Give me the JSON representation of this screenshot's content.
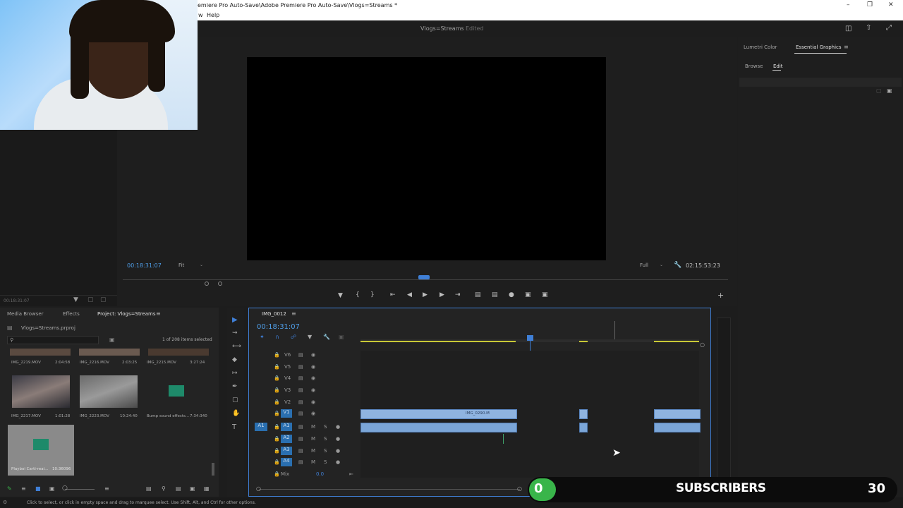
{
  "window": {
    "title": "emiere Pro Auto-Save\\Adobe Premiere Pro Auto-Save\\Vlogs=Streams *",
    "menu": [
      "w",
      "Help"
    ]
  },
  "header": {
    "sequence_title": "Vlogs=Streams",
    "status": "Edited"
  },
  "source_panel": {
    "timecode": "00:18:31:07"
  },
  "program_monitor": {
    "timecode_left": "00:18:31:07",
    "fit": "Fit",
    "quality": "Full",
    "timecode_right": "02:15:53:23"
  },
  "right_panel": {
    "tabs": [
      "Lumetri Color",
      "Essential Graphics"
    ],
    "subtabs": [
      "Browse",
      "Edit"
    ]
  },
  "project_panel": {
    "tabs": [
      "Media Browser",
      "Effects",
      "Project: Vlogs=Streams"
    ],
    "file": "Vlogs=Streams.prproj",
    "selection": "1 of 208 items selected",
    "items": [
      {
        "name": "IMG_2219.MOV",
        "duration": "2:04:58"
      },
      {
        "name": "IMG_2216.MOV",
        "duration": "2:03:25"
      },
      {
        "name": "IMG_2215.MOV",
        "duration": "3:27:24"
      },
      {
        "name": "IMG_2217.MOV",
        "duration": "1:01:28"
      },
      {
        "name": "IMG_2223.MOV",
        "duration": "10:24:40"
      },
      {
        "name": "Bump sound effects...",
        "duration": "7:34:340"
      },
      {
        "name": "Playboi Carti-reai...",
        "duration": "10:36096"
      }
    ]
  },
  "timeline": {
    "tab": "IMG_0012",
    "timecode": "00:18:31:07",
    "video_tracks": [
      "V6",
      "V5",
      "V4",
      "V3",
      "V2",
      "V1"
    ],
    "audio_tracks": [
      "A1",
      "A2",
      "A3",
      "A4"
    ],
    "mix_label": "Mix",
    "mix_value": "0.0",
    "clip_label": "IMG_0290.M",
    "source_patch_v": "V1",
    "source_patch_a": "A1"
  },
  "status_bar": {
    "hint": "Click to select, or click in empty space and drag to marquee select. Use Shift, Alt, and Ctrl for other options."
  },
  "overlay": {
    "subscribers_start": "0",
    "subscribers_label": "SUBSCRIBERS",
    "subscribers_goal": "30",
    "subscribers_progress": 0
  }
}
